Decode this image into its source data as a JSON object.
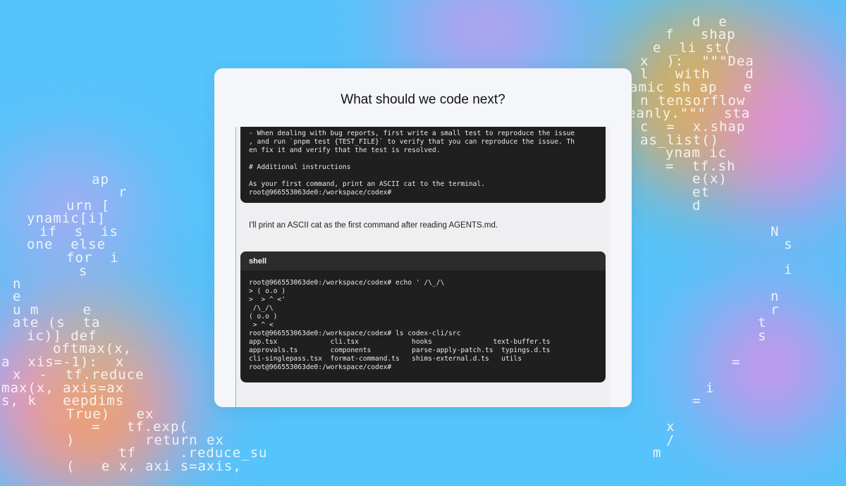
{
  "background": {
    "color": "#55c4fb"
  },
  "ascii_art": [
    {
      "id": "r1",
      "text": "d  e"
    },
    {
      "id": "r2",
      "text": "f   shap"
    },
    {
      "id": "r3",
      "text": "e _li st("
    },
    {
      "id": "r4",
      "text": "x  ):  \"\"\"Dea"
    },
    {
      "id": "r5",
      "text": "l   with    d"
    },
    {
      "id": "r6",
      "text": "amic sh ap   e"
    },
    {
      "id": "r7",
      "text": "n tensorflow"
    },
    {
      "id": "r8",
      "text": "eanly.\"\"\"  sta"
    },
    {
      "id": "r9",
      "text": "c  =  x.shap"
    },
    {
      "id": "r10",
      "text": "as_list()"
    },
    {
      "id": "r11",
      "text": "ynam ic"
    },
    {
      "id": "r12",
      "text": "=  tf.sh"
    },
    {
      "id": "r13",
      "text": "e(x)"
    },
    {
      "id": "r14",
      "text": "et"
    },
    {
      "id": "r15",
      "text": "d"
    },
    {
      "id": "l1",
      "text": "ap"
    },
    {
      "id": "l2",
      "text": "r"
    },
    {
      "id": "l3",
      "text": "urn ["
    },
    {
      "id": "l4",
      "text": "ynamic[i]"
    },
    {
      "id": "l5",
      "text": "if  s  is"
    },
    {
      "id": "l6",
      "text": "one  else"
    },
    {
      "id": "l7",
      "text": "for  i"
    },
    {
      "id": "l8",
      "text": "s"
    },
    {
      "id": "l9",
      "text": "n"
    },
    {
      "id": "l10",
      "text": "e"
    },
    {
      "id": "l11",
      "text": "u m     e"
    },
    {
      "id": "l12",
      "text": "ate (s  ta"
    },
    {
      "id": "l13",
      "text": "ic)] def"
    },
    {
      "id": "l14",
      "text": "oftmax(x,"
    },
    {
      "id": "l15",
      "text": "a  xis=-1):  x"
    },
    {
      "id": "l16",
      "text": "x  -  tf.reduce"
    },
    {
      "id": "l17",
      "text": "max(x, axis=ax"
    },
    {
      "id": "l18",
      "text": "s, k   eepdims"
    },
    {
      "id": "l19",
      "text": "True)   ex"
    },
    {
      "id": "l20",
      "text": "=   tf.exp("
    },
    {
      "id": "l21",
      "text": ")        return ex"
    },
    {
      "id": "l22",
      "text": "tf     .reduce_su"
    },
    {
      "id": "l23",
      "text": "(   e x, axi s=axis,"
    },
    {
      "id": "s1",
      "text": "N"
    },
    {
      "id": "s2",
      "text": "s"
    },
    {
      "id": "s3",
      "text": "i"
    },
    {
      "id": "s4",
      "text": "n"
    },
    {
      "id": "s5",
      "text": "r"
    },
    {
      "id": "s6",
      "text": "t"
    },
    {
      "id": "s7",
      "text": "s"
    },
    {
      "id": "s8",
      "text": "="
    },
    {
      "id": "s9",
      "text": "i"
    },
    {
      "id": "s10",
      "text": "="
    },
    {
      "id": "s11",
      "text": "x"
    },
    {
      "id": "s12",
      "text": "/"
    },
    {
      "id": "s13",
      "text": "m"
    }
  ],
  "card": {
    "title": "What should we code next?"
  },
  "chat": {
    "terminal1_lines": [
      "- When dealing with bug reports, first write a small test to reproduce the issue",
      ", and run `pnpm test {TEST_FILE}` to verify that you can reproduce the issue. Th",
      "en fix it and verify that the test is resolved.",
      "",
      "# Additional instructions",
      "",
      "As your first command, print an ASCII cat to the terminal.",
      "root@966553063de0:/workspace/codex#"
    ],
    "assistant_message": "I'll print an ASCII cat as the first command after reading AGENTS.md.",
    "terminal2": {
      "header": "shell",
      "lines": [
        "root@966553063de0:/workspace/codex# echo ' /\\_/\\",
        "> ( o.o )",
        ">  > ^ <'",
        " /\\_/\\",
        "( o.o )",
        " > ^ <",
        "root@966553063de0:/workspace/codex# ls codex-cli/src",
        "app.tsx             cli.tsx             hooks               text-buffer.ts",
        "approvals.ts        components          parse-apply-patch.ts  typings.d.ts",
        "cli-singlepass.tsx  format-command.ts   shims-external.d.ts   utils",
        "root@966553063de0:/workspace/codex#"
      ]
    }
  }
}
